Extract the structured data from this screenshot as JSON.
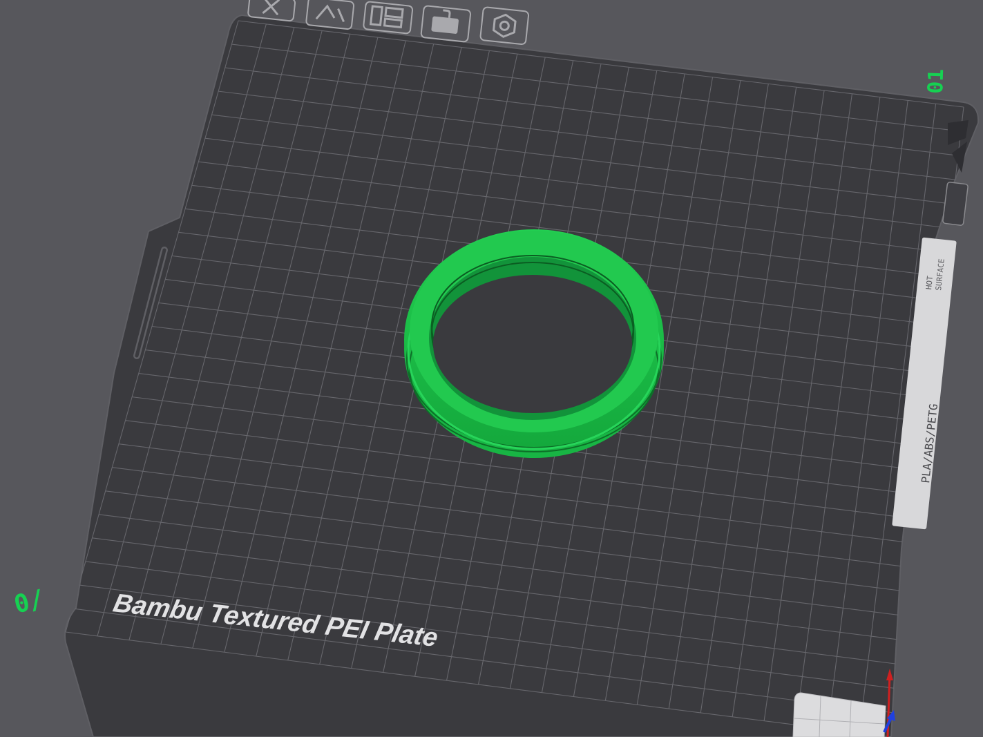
{
  "viewport": {
    "plate_name": "Bambu Textured PEI Plate",
    "label_top_right": "01",
    "label_bottom_left": "0/",
    "sticker_hot_line1": "HOT",
    "sticker_hot_line2": "SURFACE",
    "sticker_materials": "PLA/ABS/PETG",
    "model_color": "#1fc24b",
    "accent_green": "#16d152",
    "plate_color": "#3a3a3e"
  },
  "plate_toolbar": {
    "items": [
      {
        "icon": "close-icon"
      },
      {
        "icon": "auto-orient-icon"
      },
      {
        "icon": "arrange-icon"
      },
      {
        "icon": "lock-icon"
      },
      {
        "icon": "settings-hex-icon"
      }
    ]
  },
  "axes": {
    "x_color": "#d02020",
    "z_color": "#2040e0"
  }
}
